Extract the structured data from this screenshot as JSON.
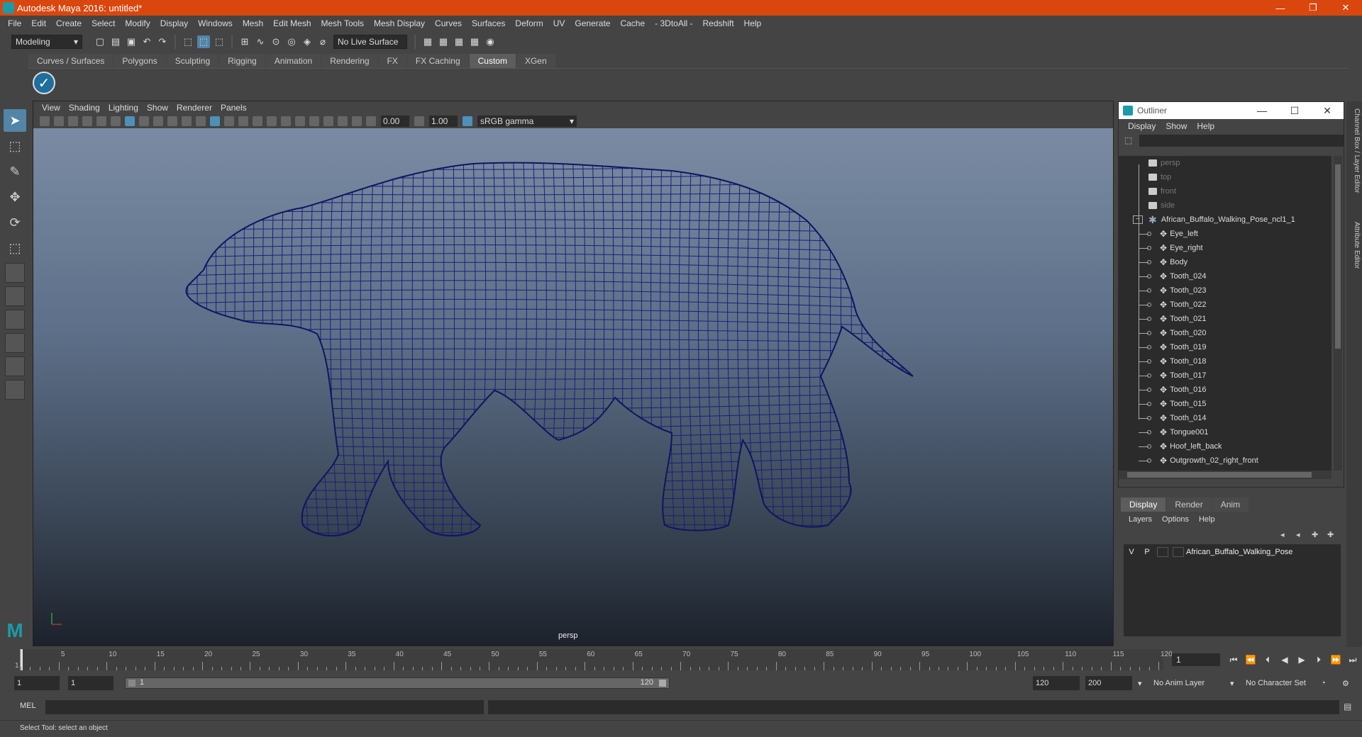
{
  "window": {
    "title": "Autodesk Maya 2016: untitled*",
    "controls": [
      "—",
      "❐",
      "✕"
    ]
  },
  "menubar": [
    "File",
    "Edit",
    "Create",
    "Select",
    "Modify",
    "Display",
    "Windows",
    "Mesh",
    "Edit Mesh",
    "Mesh Tools",
    "Mesh Display",
    "Curves",
    "Surfaces",
    "Deform",
    "UV",
    "Generate",
    "Cache",
    "- 3DtoAll -",
    "Redshift",
    "Help"
  ],
  "statusline": {
    "mode": "Modeling",
    "live_surface": "No Live Surface"
  },
  "shelf": {
    "tabs": [
      "Curves / Surfaces",
      "Polygons",
      "Sculpting",
      "Rigging",
      "Animation",
      "Rendering",
      "FX",
      "FX Caching",
      "Custom",
      "XGen"
    ],
    "active": "Custom"
  },
  "viewport": {
    "menu": [
      "View",
      "Shading",
      "Lighting",
      "Show",
      "Renderer",
      "Panels"
    ],
    "exposure": "0.00",
    "gamma": "1.00",
    "color_space": "sRGB gamma",
    "camera": "persp",
    "background_top": "#7a8ba3",
    "wire_color": "#1a1f7a"
  },
  "outliner": {
    "title": "Outliner",
    "menu": [
      "Display",
      "Show",
      "Help"
    ],
    "cameras": [
      "persp",
      "top",
      "front",
      "side"
    ],
    "group": "African_Buffalo_Walking_Pose_ncl1_1",
    "children": [
      "Eye_left",
      "Eye_right",
      "Body",
      "Tooth_024",
      "Tooth_023",
      "Tooth_022",
      "Tooth_021",
      "Tooth_020",
      "Tooth_019",
      "Tooth_018",
      "Tooth_017",
      "Tooth_016",
      "Tooth_015",
      "Tooth_014",
      "Tongue001",
      "Hoof_left_back",
      "Outgrowth_02_right_front"
    ]
  },
  "layer_editor": {
    "tabs": [
      "Display",
      "Render",
      "Anim"
    ],
    "active": "Display",
    "menu": [
      "Layers",
      "Options",
      "Help"
    ],
    "layer": {
      "v": "V",
      "p": "P",
      "name": "African_Buffalo_Walking_Pose"
    }
  },
  "right_tabs": [
    "Channel Box / Layer Editor",
    "Attribute Editor"
  ],
  "timeline": {
    "labels": [
      "5",
      "10",
      "15",
      "20",
      "25",
      "30",
      "35",
      "40",
      "45",
      "50",
      "55",
      "60",
      "65",
      "70",
      "75",
      "80",
      "85",
      "90",
      "95",
      "100",
      "105",
      "110",
      "115",
      "120"
    ],
    "start_label": "1",
    "current_frame": "1"
  },
  "range": {
    "start": "1",
    "playback_start": "1",
    "slider_start": "1",
    "slider_end": "120",
    "playback_end": "120",
    "end": "200",
    "anim_layer": "No Anim Layer",
    "character_set": "No Character Set"
  },
  "command": {
    "lang": "MEL"
  },
  "help_line": "Select Tool: select an object"
}
